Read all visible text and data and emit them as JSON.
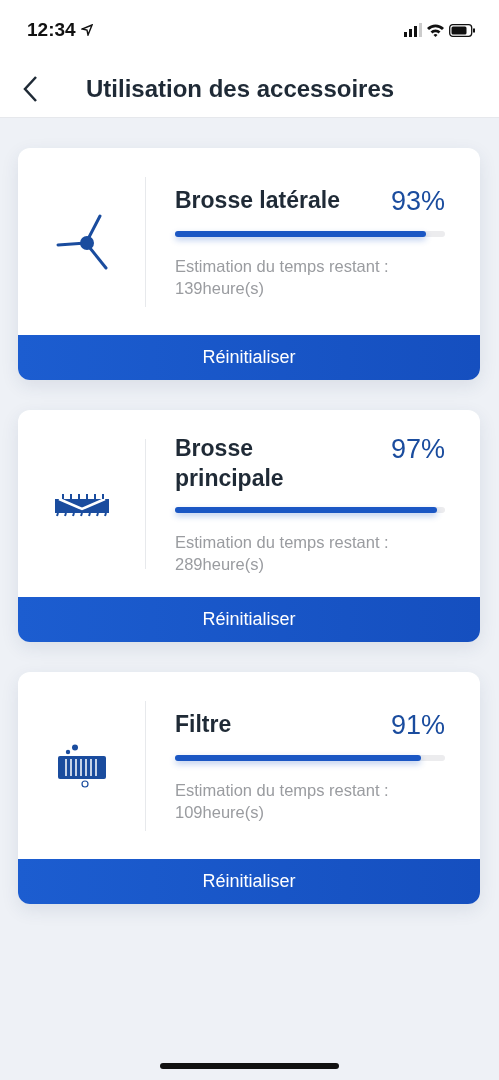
{
  "status_bar": {
    "time": "12:34"
  },
  "header": {
    "title": "Utilisation des accessoires"
  },
  "accessories": [
    {
      "kind": "side_brush",
      "name": "Brosse latérale",
      "percent": "93%",
      "level": 0.93,
      "estimate": "Estimation du temps restant : 139heure(s)",
      "button": "Réinitialiser"
    },
    {
      "kind": "main_brush",
      "name": "Brosse principale",
      "percent": "97%",
      "level": 0.97,
      "estimate": "Estimation du temps restant : 289heure(s)",
      "button": "Réinitialiser"
    },
    {
      "kind": "filter",
      "name": "Filtre",
      "percent": "91%",
      "level": 0.91,
      "estimate": "Estimation du temps restant : 109heure(s)",
      "button": "Réinitialiser"
    }
  ]
}
